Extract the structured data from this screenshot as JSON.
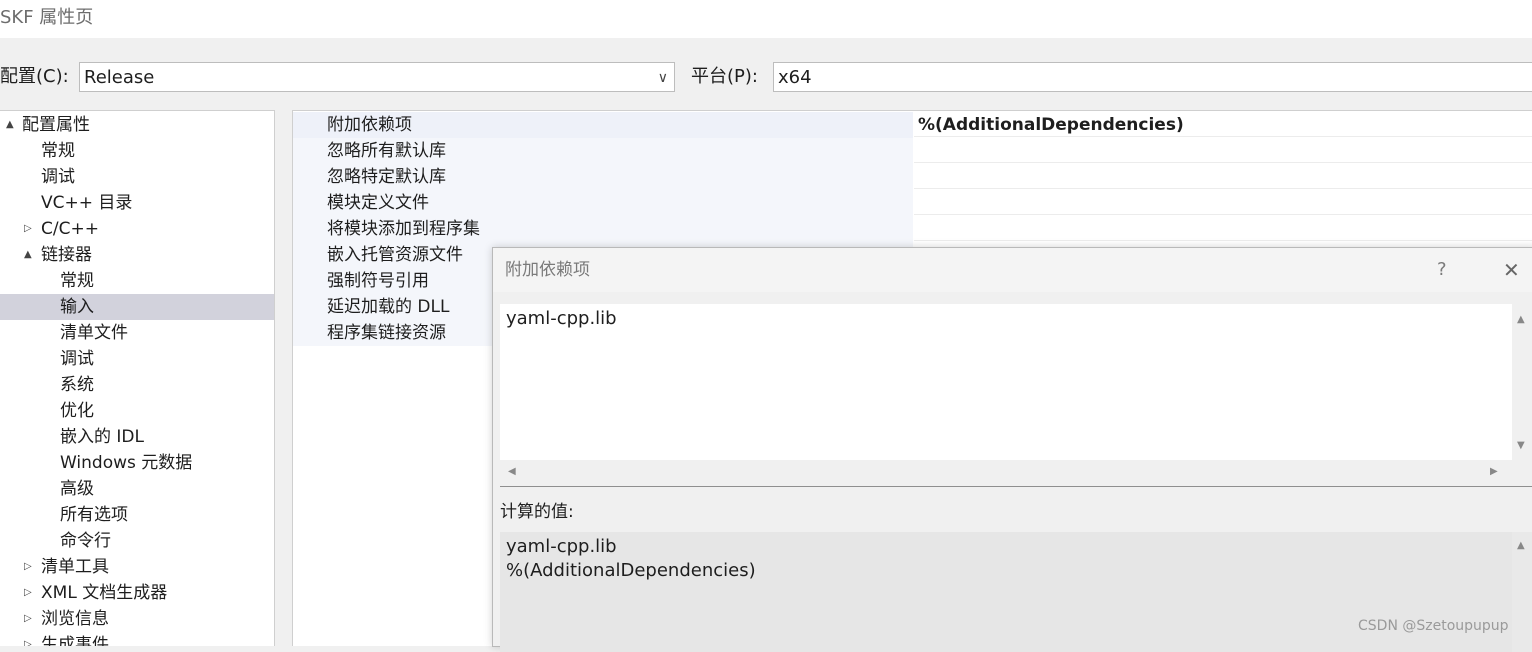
{
  "window": {
    "title": "SKF 属性页"
  },
  "config": {
    "config_label": "配置(C):",
    "config_value": "Release",
    "platform_label": "平台(P):",
    "platform_value": "x64"
  },
  "tree": {
    "items": [
      {
        "label": "配置属性",
        "expander": "▲"
      },
      {
        "label": "常规",
        "expander": ""
      },
      {
        "label": "调试",
        "expander": ""
      },
      {
        "label": "VC++ 目录",
        "expander": ""
      },
      {
        "label": "C/C++",
        "expander": "▷"
      },
      {
        "label": "链接器",
        "expander": "▲"
      },
      {
        "label": "常规",
        "expander": ""
      },
      {
        "label": "输入",
        "expander": ""
      },
      {
        "label": "清单文件",
        "expander": ""
      },
      {
        "label": "调试",
        "expander": ""
      },
      {
        "label": "系统",
        "expander": ""
      },
      {
        "label": "优化",
        "expander": ""
      },
      {
        "label": "嵌入的 IDL",
        "expander": ""
      },
      {
        "label": "Windows 元数据",
        "expander": ""
      },
      {
        "label": "高级",
        "expander": ""
      },
      {
        "label": "所有选项",
        "expander": ""
      },
      {
        "label": "命令行",
        "expander": ""
      },
      {
        "label": "清单工具",
        "expander": "▷"
      },
      {
        "label": "XML 文档生成器",
        "expander": "▷"
      },
      {
        "label": "浏览信息",
        "expander": "▷"
      },
      {
        "label": "生成事件",
        "expander": "▷"
      }
    ]
  },
  "properties": {
    "rows": [
      {
        "name": "附加依赖项",
        "value": "%(AdditionalDependencies)"
      },
      {
        "name": "忽略所有默认库",
        "value": ""
      },
      {
        "name": "忽略特定默认库",
        "value": ""
      },
      {
        "name": "模块定义文件",
        "value": ""
      },
      {
        "name": "将模块添加到程序集",
        "value": ""
      },
      {
        "name": "嵌入托管资源文件",
        "value": ""
      },
      {
        "name": "强制符号引用",
        "value": ""
      },
      {
        "name": "延迟加载的 DLL",
        "value": ""
      },
      {
        "name": "程序集链接资源",
        "value": ""
      }
    ]
  },
  "dialog": {
    "title": "附加依赖项",
    "help": "?",
    "close": "✕",
    "edit_text": "yaml-cpp.lib",
    "computed_label": "计算的值:",
    "computed_lines": [
      "yaml-cpp.lib",
      "%(AdditionalDependencies)"
    ],
    "arrows": {
      "up": "▲",
      "down": "▼",
      "left": "◀",
      "right": "▶"
    }
  },
  "watermark": "CSDN @Szetoupupup"
}
